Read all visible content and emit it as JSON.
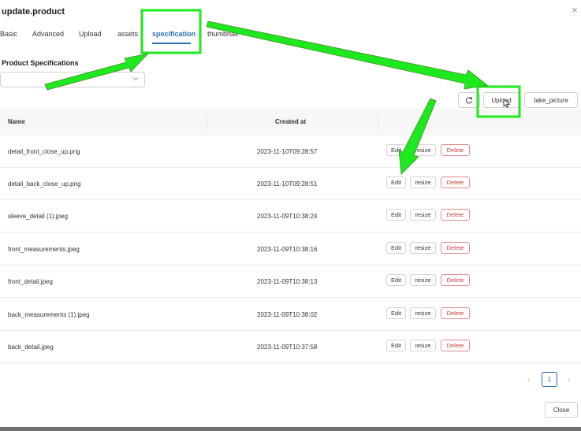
{
  "dialog": {
    "title": "update.product",
    "close_glyph": "×"
  },
  "tabs": [
    {
      "label": "Basic"
    },
    {
      "label": "Advanced"
    },
    {
      "label": "Upload"
    },
    {
      "label": "assets"
    },
    {
      "label": "specification",
      "active": true
    },
    {
      "label": "thumbnail"
    }
  ],
  "section": {
    "label": "Product Specifications",
    "select_value": ""
  },
  "toolbar": {
    "refresh_icon": "refresh-icon",
    "upload_label": "Upload",
    "take_picture_label": "take_picture"
  },
  "table": {
    "columns": [
      "Name",
      "Created at"
    ],
    "rows": [
      {
        "name": "detail_front_close_up.png",
        "created_at": "2023-11-10T09:28:57",
        "edit": "Edit",
        "resize": "resize",
        "delete": "Delete"
      },
      {
        "name": "detail_back_close_up.png",
        "created_at": "2023-11-10T09:28:51",
        "edit": "Edit",
        "resize": "resize",
        "delete": "Delete"
      },
      {
        "name": "sleeve_detail (1).jpeg",
        "created_at": "2023-11-09T10:38:24",
        "edit": "Edit",
        "resize": "resize",
        "delete": "Delete"
      },
      {
        "name": "front_measurements.jpeg",
        "created_at": "2023-11-09T10:38:16",
        "edit": "Edit",
        "resize": "resize",
        "delete": "Delete"
      },
      {
        "name": "front_detail.jpeg",
        "created_at": "2023-11-09T10:38:13",
        "edit": "Edit",
        "resize": "resize",
        "delete": "Delete"
      },
      {
        "name": "back_measurements (1).jpeg",
        "created_at": "2023-11-09T10:38:02",
        "edit": "Edit",
        "resize": "resize",
        "delete": "Delete"
      },
      {
        "name": "back_detail.jpeg",
        "created_at": "2023-11-09T10:37:58",
        "edit": "Edit",
        "resize": "resize",
        "delete": "Delete"
      }
    ]
  },
  "pagination": {
    "current_page": "1",
    "prev_glyph": "‹",
    "next_glyph": "›"
  },
  "footer": {
    "close_label": "Close"
  },
  "colors": {
    "accent": "#2a6ebb",
    "danger": "#d03b3b",
    "annotation_green": "#1ee81e"
  }
}
